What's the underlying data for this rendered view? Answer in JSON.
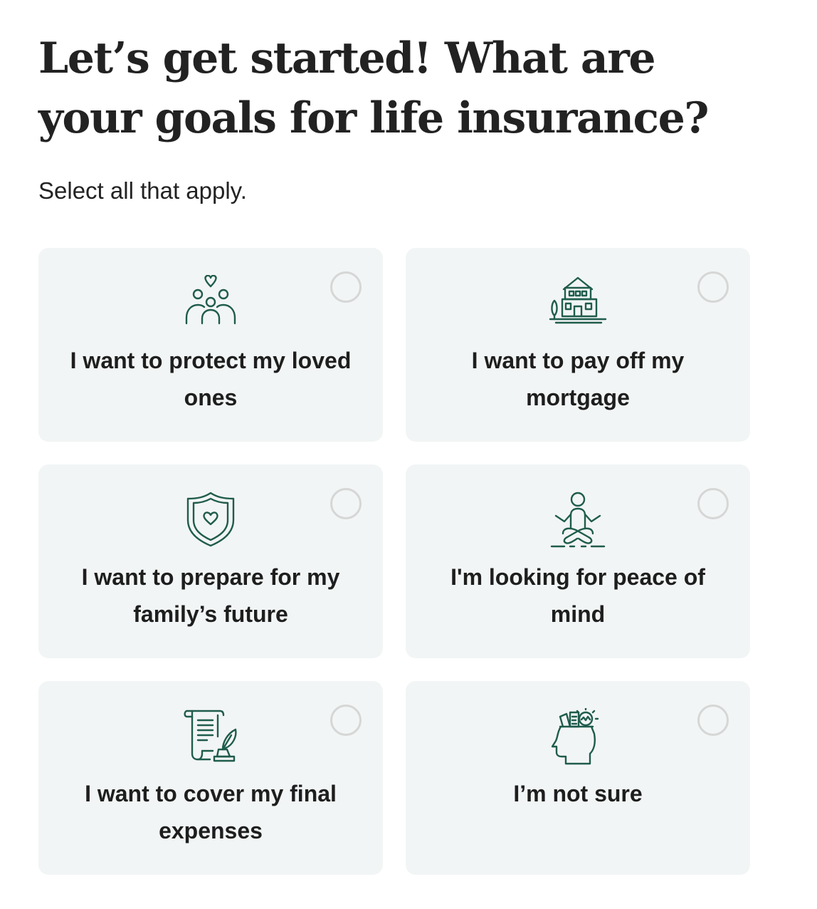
{
  "header": {
    "title": "Let’s get started! What are your goals for life insurance?",
    "subtitle": "Select all that apply."
  },
  "colors": {
    "icon": "#1f5c4c",
    "card_background": "#f2f5f5",
    "radio_border": "#d6d6d6",
    "text": "#222222"
  },
  "options": [
    {
      "label": "I want to protect my loved ones",
      "icon": "family-heart-icon",
      "selected": false
    },
    {
      "label": "I want to pay off my mortgage",
      "icon": "house-icon",
      "selected": false
    },
    {
      "label": "I want to prepare for my family’s future",
      "icon": "shield-heart-icon",
      "selected": false
    },
    {
      "label": "I'm looking for peace of mind",
      "icon": "meditation-icon",
      "selected": false
    },
    {
      "label": "I want to cover my final expenses",
      "icon": "scroll-quill-icon",
      "selected": false
    },
    {
      "label": "I’m not sure",
      "icon": "thinking-head-icon",
      "selected": false
    }
  ]
}
